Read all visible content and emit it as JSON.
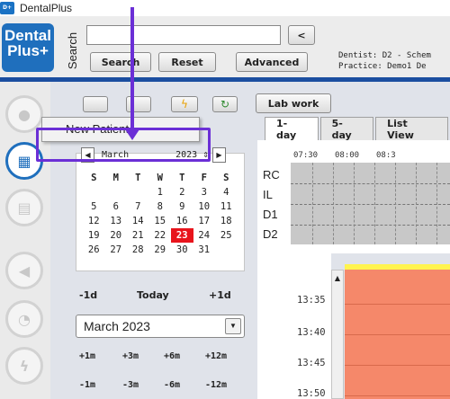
{
  "window": {
    "title": "DentalPlus"
  },
  "header": {
    "logo_line1": "Dental",
    "logo_line2": "Plus+",
    "search_label": "Search",
    "search_value": "",
    "buttons": {
      "collapse": "<",
      "search": "Search",
      "reset": "Reset",
      "advanced": "Advanced"
    },
    "info_dentist": "Dentist: D2 - Schem",
    "info_practice": "Practice: Demo1 De"
  },
  "toolbar": {
    "lab_work": "Lab work"
  },
  "context_menu": {
    "new_patient": "New Patient"
  },
  "calendar": {
    "month": "March",
    "year": "2023",
    "weekdays": [
      "S",
      "M",
      "T",
      "W",
      "T",
      "F",
      "S"
    ],
    "weeks": [
      [
        "",
        "",
        "",
        "1",
        "2",
        "3",
        "4"
      ],
      [
        "5",
        "6",
        "7",
        "8",
        "9",
        "10",
        "11"
      ],
      [
        "12",
        "13",
        "14",
        "15",
        "16",
        "17",
        "18"
      ],
      [
        "19",
        "20",
        "21",
        "22",
        "23",
        "24",
        "25"
      ],
      [
        "26",
        "27",
        "28",
        "29",
        "30",
        "31",
        ""
      ]
    ],
    "today_date": "23",
    "nav": {
      "minus_day": "-1d",
      "today": "Today",
      "plus_day": "+1d"
    },
    "month_select": "March 2023",
    "jumps_forward": [
      "+1m",
      "+3m",
      "+6m",
      "+12m"
    ],
    "jumps_back": [
      "-1m",
      "-3m",
      "-6m",
      "-12m"
    ]
  },
  "schedule": {
    "tabs": [
      "1-day",
      "5-day",
      "List View"
    ],
    "active_tab": "1-day",
    "rows": [
      "RC",
      "IL",
      "D1",
      "D2"
    ],
    "header_times": [
      "07:30",
      "08:00",
      "08:3"
    ],
    "time_slots": [
      "13:35",
      "13:40",
      "13:45",
      "13:50"
    ],
    "slot_color": "#f5886a"
  },
  "colors": {
    "accent": "#1f6fbd",
    "annotation": "#6b2fd6",
    "today": "#e8141c"
  }
}
